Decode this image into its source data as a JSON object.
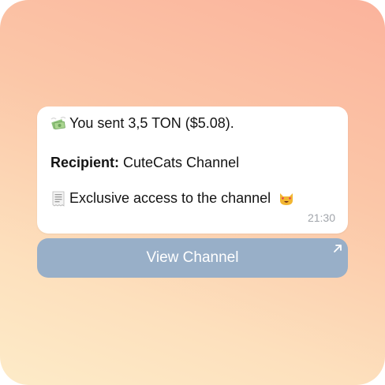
{
  "message": {
    "sent_line": "You sent 3,5 TON ($5.08).",
    "recipient_label": "Recipient:",
    "recipient_name": "CuteCats Channel",
    "description": "Exclusive access to the channel",
    "time": "21:30",
    "icons": {
      "money": "money-with-wings-icon",
      "receipt": "receipt-icon",
      "cat": "heart-eyes-cat-icon"
    }
  },
  "action": {
    "label": "View Channel",
    "icon": "arrow-up-right-icon"
  },
  "colors": {
    "button_bg": "#98afc8",
    "bubble_bg": "#ffffff",
    "time": "#a1a5ab"
  }
}
